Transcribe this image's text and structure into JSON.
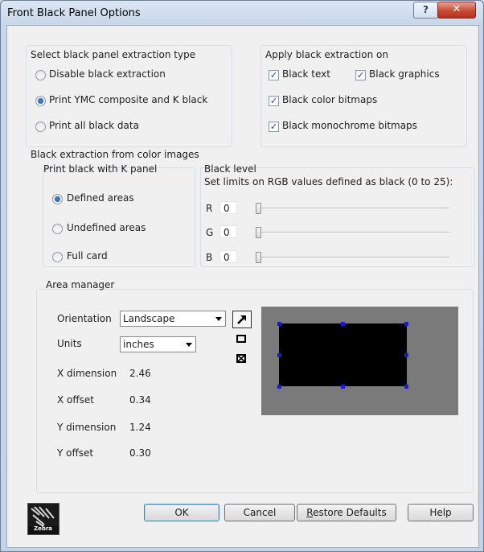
{
  "window": {
    "title": "Front Black Panel Options",
    "help_label": "?",
    "close_label": "✕"
  },
  "extraction_type": {
    "heading": "Select black panel extraction type",
    "options": [
      "Disable black extraction",
      "Print YMC composite and K black",
      "Print all black data"
    ],
    "selected": "Print YMC composite and K black"
  },
  "apply_on": {
    "heading": "Apply black extraction on",
    "options": [
      {
        "label": "Black text",
        "checked": true
      },
      {
        "label": "Black graphics",
        "checked": true
      },
      {
        "label": "Black color bitmaps",
        "checked": true
      },
      {
        "label": "Black monochrome bitmaps",
        "checked": true
      }
    ]
  },
  "color_images": {
    "heading": "Black extraction from color images",
    "k_panel": {
      "heading": "Print black with K panel",
      "options": [
        "Defined areas",
        "Undefined areas",
        "Full card"
      ],
      "selected": "Defined areas"
    },
    "black_level": {
      "heading": "Black level",
      "description": "Set limits on RGB values defined as black (0 to 25):",
      "channels": [
        {
          "name": "R",
          "value": "0"
        },
        {
          "name": "G",
          "value": "0"
        },
        {
          "name": "B",
          "value": "0"
        }
      ]
    }
  },
  "area_manager": {
    "heading": "Area manager",
    "orientation_label": "Orientation",
    "orientation_value": "Landscape",
    "units_label": "Units",
    "units_value": "inches",
    "x_dimension_label": "X dimension",
    "x_dimension_value": "2.46",
    "x_offset_label": "X offset",
    "x_offset_value": "0.34",
    "y_dimension_label": "Y dimension",
    "y_dimension_value": "1.24",
    "y_offset_label": "Y offset",
    "y_offset_value": "0.30",
    "tools": [
      "select-arrow-icon",
      "add-rectangle-icon",
      "delete-rectangle-icon"
    ]
  },
  "footer": {
    "logo_text": "Zebra",
    "ok_label": "OK",
    "cancel_label": "Cancel",
    "restore_label": "Restore Defaults",
    "help_label": "Help"
  },
  "colors": {
    "preview_background": "#7a7a7a",
    "area_fill": "#000000",
    "handle_color": "#1a1ad0",
    "close_button": "#c84a33"
  }
}
